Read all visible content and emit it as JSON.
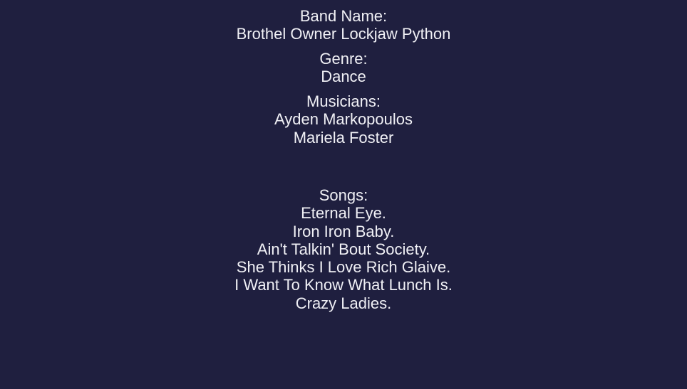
{
  "band": {
    "label": "Band Name:",
    "value": "Brothel Owner Lockjaw Python"
  },
  "genre": {
    "label": "Genre:",
    "value": "Dance"
  },
  "musicians": {
    "label": "Musicians:",
    "items": [
      "Ayden Markopoulos",
      "Mariela Foster"
    ]
  },
  "songs": {
    "label": "Songs:",
    "items": [
      "Eternal Eye.",
      "Iron Iron Baby.",
      "Ain't Talkin' Bout Society.",
      "She Thinks I Love Rich Glaive.",
      "I Want To Know What Lunch Is.",
      "Crazy Ladies."
    ]
  },
  "colors": {
    "background": "#1f1f3f",
    "text": "#f0f0f5"
  }
}
